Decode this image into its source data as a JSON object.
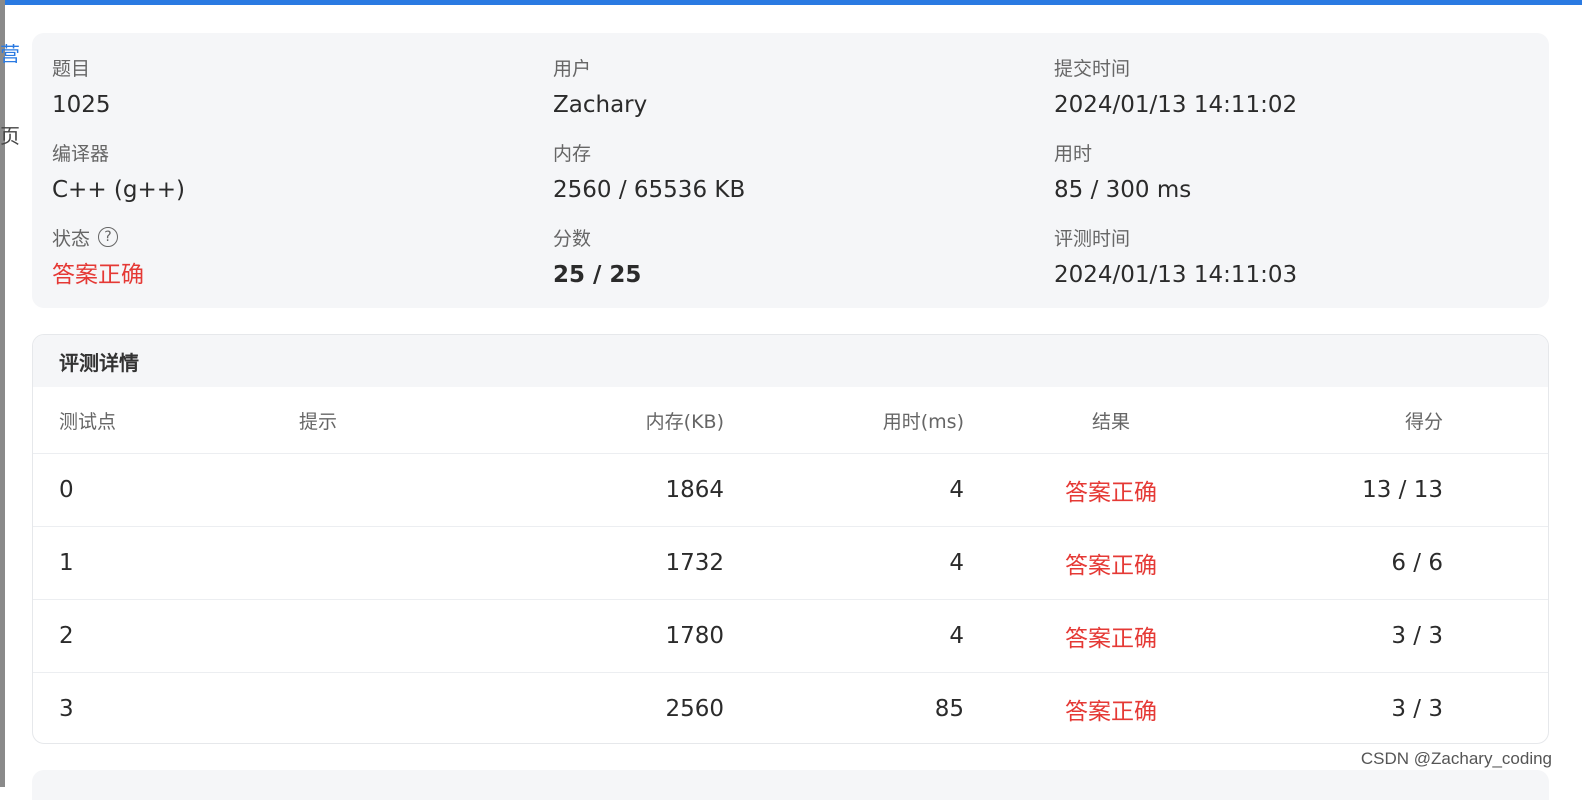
{
  "left_fragments": [
    "营",
    "页"
  ],
  "summary": {
    "problem": {
      "label": "题目",
      "value": "1025"
    },
    "user": {
      "label": "用户",
      "value": "Zachary"
    },
    "submit_time": {
      "label": "提交时间",
      "value": "2024/01/13 14:11:02"
    },
    "compiler": {
      "label": "编译器",
      "value": "C++ (g++)"
    },
    "memory": {
      "label": "内存",
      "value": "2560 / 65536 KB"
    },
    "time_used": {
      "label": "用时",
      "value": "85 / 300 ms"
    },
    "status": {
      "label": "状态",
      "value": "答案正确",
      "help_icon": "question-circle-icon"
    },
    "score": {
      "label": "分数",
      "value": "25 / 25"
    },
    "judge_time": {
      "label": "评测时间",
      "value": "2024/01/13 14:11:03"
    }
  },
  "details": {
    "title": "评测详情",
    "columns": [
      "测试点",
      "提示",
      "内存(KB)",
      "用时(ms)",
      "结果",
      "得分"
    ],
    "rows": [
      {
        "point": "0",
        "hint": "",
        "memory": "1864",
        "time": "4",
        "result": "答案正确",
        "score": "13 / 13"
      },
      {
        "point": "1",
        "hint": "",
        "memory": "1732",
        "time": "4",
        "result": "答案正确",
        "score": "6 / 6"
      },
      {
        "point": "2",
        "hint": "",
        "memory": "1780",
        "time": "4",
        "result": "答案正确",
        "score": "3 / 3"
      },
      {
        "point": "3",
        "hint": "",
        "memory": "2560",
        "time": "85",
        "result": "答案正确",
        "score": "3 / 3"
      }
    ]
  },
  "watermark": "CSDN @Zachary_coding",
  "colors": {
    "accent": "#2a7ae2",
    "status_ok": "#e53935",
    "panel_bg": "#f5f6f8"
  }
}
